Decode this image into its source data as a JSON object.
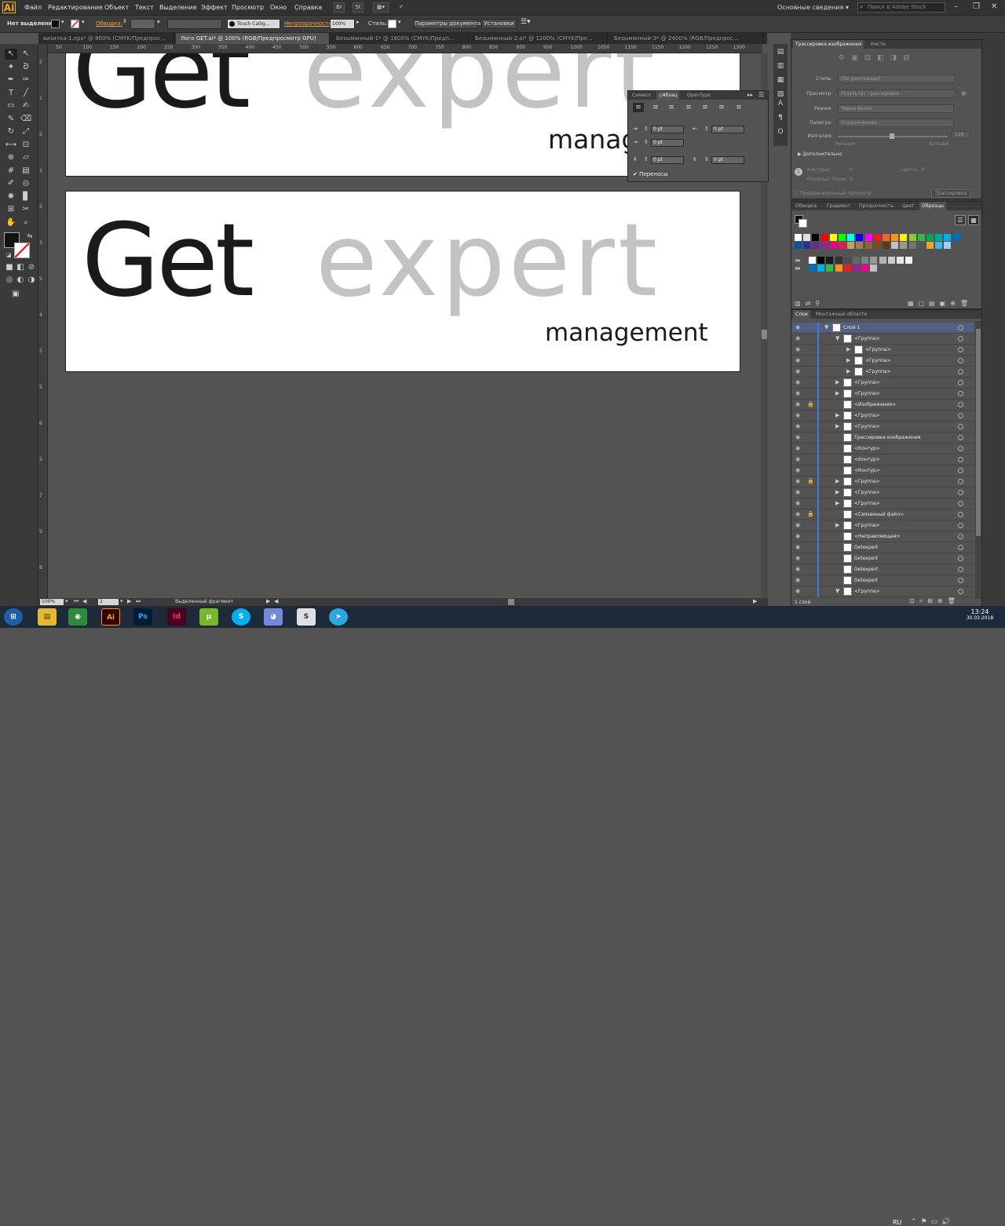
{
  "app": {
    "logo": "Ai"
  },
  "menu": [
    "Файл",
    "Редактирование",
    "Объект",
    "Текст",
    "Выделение",
    "Эффект",
    "Просмотр",
    "Окно",
    "Справка"
  ],
  "workspace": "Основные сведения",
  "search_placeholder": "Поиск в Adobe Stock",
  "control": {
    "selection": "Нет выделения",
    "stroke_label": "Обводка:",
    "brush": "Touch Callig...",
    "opacity_label": "Непрозрачность:",
    "opacity_value": "100%",
    "style_label": "Стиль:",
    "doc_params": "Параметры документа",
    "settings": "Установки"
  },
  "tabs": [
    "визитка-1.eps* @ 800% (CMYK/Предпрос...",
    "Лого GET.ai* @ 100% (RGB/Предпросмотр GPU)",
    "Безымянный-1* @ 1600% (CMYK/Предп...",
    "Безымянный-2.ai* @ 1200% (CMYK/Пре...",
    "Безымянный-3* @ 2400% (RGB/Предпрос..."
  ],
  "ruler_ticks": [
    "50",
    "100",
    "150",
    "200",
    "250",
    "300",
    "350",
    "400",
    "450",
    "500",
    "550",
    "600",
    "650",
    "700",
    "750",
    "800",
    "850",
    "900",
    "950",
    "1000",
    "1050",
    "1100",
    "1150",
    "1200",
    "1250",
    "1300"
  ],
  "ruler_v_ticks": [
    "5",
    "1",
    "5",
    "2",
    "5",
    "3",
    "5",
    "4",
    "5",
    "5",
    "6",
    "5",
    "7",
    "5",
    "8"
  ],
  "artboard1": {
    "get": "Get",
    "expert": "expert",
    "management": "manag"
  },
  "artboard2": {
    "get": "Get",
    "expert": "expert",
    "management": "management"
  },
  "para": {
    "tabs": [
      "Символ",
      "Абзац",
      "OpenType"
    ],
    "field": "0 pt",
    "hyphen": "Переносы"
  },
  "trace": {
    "tabs": [
      "Трассировка изображения",
      "Кисти"
    ],
    "style_label": "Стиль:",
    "style_value": "[По умолчанию]",
    "view_label": "Просмотр:",
    "view_value": "Результат трассировки",
    "mode_label": "Режим:",
    "mode_value": "Черно-белое",
    "palette_label": "Палитра:",
    "palette_value": "Ограниченная",
    "threshold_label": "Изогелия:",
    "threshold_value": "128",
    "less": "Меньше",
    "more": "Больше",
    "advanced": "Дополнительно",
    "paths_label": "Контуры:",
    "paths_value": "0",
    "anchors_label": "Опорные точки:",
    "anchors_value": "0",
    "colors_label": "Цвета:",
    "colors_value": "0",
    "preview": "Предварительный просмотр",
    "trace_btn": "Трассировка"
  },
  "swatches_tabs": [
    "Обводка",
    "Градиент",
    "Прозрачность",
    "Цвет",
    "Образцы"
  ],
  "swatch_colors": [
    [
      "#ffffff",
      "#e0e0e0",
      "#000000",
      "#ff0000",
      "#ffff00",
      "#00ff00",
      "#00ffff",
      "#0000ff",
      "#ff00ff",
      "#ed1c24",
      "#f26522",
      "#f7941d",
      "#fff200",
      "#8dc63f",
      "#39b54a",
      "#00a651",
      "#00a99d",
      "#00aeef",
      "#0072bc"
    ],
    [
      "#0054a6",
      "#2e3192",
      "#662d91",
      "#92278f",
      "#ec008c",
      "#ed145b",
      "#c69c6d",
      "#a67c52",
      "#8c6239",
      "#754c24",
      "#603913",
      "#c2c2c2",
      "#999999",
      "#737373",
      "#555555",
      "#f0a030",
      "#42b4e6",
      "#a0d0f0"
    ],
    [
      "#ffffff",
      "#000000",
      "#1a1a1a",
      "#333333",
      "#4d4d4d",
      "#666666",
      "#808080",
      "#999999",
      "#b3b3b3",
      "#cccccc",
      "#e6e6e6",
      "#f2f2f2"
    ],
    [
      "#0072bc",
      "#00aeef",
      "#39b54a",
      "#f7941d",
      "#ed1c24",
      "#92278f",
      "#ec008c",
      "#c2c2c2"
    ]
  ],
  "layers_tabs": [
    "Слои",
    "Монтажные области"
  ],
  "layers": [
    {
      "name": "Слой 1",
      "indent": 0,
      "arrow": "▼",
      "lock": false
    },
    {
      "name": "<Группа>",
      "indent": 1,
      "arrow": "▼",
      "lock": false
    },
    {
      "name": "<Группа>",
      "indent": 2,
      "arrow": "▶",
      "lock": false
    },
    {
      "name": "<Группа>",
      "indent": 2,
      "arrow": "▶",
      "lock": false
    },
    {
      "name": "<Группа>",
      "indent": 2,
      "arrow": "▶",
      "lock": false
    },
    {
      "name": "<Группа>",
      "indent": 1,
      "arrow": "▶",
      "lock": false
    },
    {
      "name": "<Группа>",
      "indent": 1,
      "arrow": "▶",
      "lock": false
    },
    {
      "name": "<Изображение>",
      "indent": 1,
      "arrow": "",
      "lock": true
    },
    {
      "name": "<Группа>",
      "indent": 1,
      "arrow": "▶",
      "lock": false
    },
    {
      "name": "<Группа>",
      "indent": 1,
      "arrow": "▶",
      "lock": false
    },
    {
      "name": "Трассировка изображения",
      "indent": 1,
      "arrow": "",
      "lock": false
    },
    {
      "name": "<Контур>",
      "indent": 1,
      "arrow": "",
      "lock": false
    },
    {
      "name": "<Контур>",
      "indent": 1,
      "arrow": "",
      "lock": false
    },
    {
      "name": "<Контур>",
      "indent": 1,
      "arrow": "",
      "lock": false
    },
    {
      "name": "<Группа>",
      "indent": 1,
      "arrow": "▶",
      "lock": true
    },
    {
      "name": "<Группа>",
      "indent": 1,
      "arrow": "▶",
      "lock": false
    },
    {
      "name": "<Группа>",
      "indent": 1,
      "arrow": "▶",
      "lock": false
    },
    {
      "name": "<Связанный файл>",
      "indent": 1,
      "arrow": "",
      "lock": true
    },
    {
      "name": "<Группа>",
      "indent": 1,
      "arrow": "▶",
      "lock": false
    },
    {
      "name": "<Направляющая>",
      "indent": 1,
      "arrow": "",
      "lock": false
    },
    {
      "name": "Getexpert",
      "indent": 1,
      "arrow": "",
      "lock": false
    },
    {
      "name": "Getexpert",
      "indent": 1,
      "arrow": "",
      "lock": false
    },
    {
      "name": "Getexpert",
      "indent": 1,
      "arrow": "",
      "lock": false
    },
    {
      "name": "Getexpert",
      "indent": 1,
      "arrow": "",
      "lock": false
    },
    {
      "name": "<Группа>",
      "indent": 1,
      "arrow": "▼",
      "lock": false
    }
  ],
  "layers_count": "1 слой",
  "status": {
    "zoom": "100%",
    "artboard": "2",
    "tool": "Выделенный фрагмент"
  },
  "taskbar": {
    "lang": "RU",
    "time": "13:24",
    "date": "30.03.2018"
  }
}
